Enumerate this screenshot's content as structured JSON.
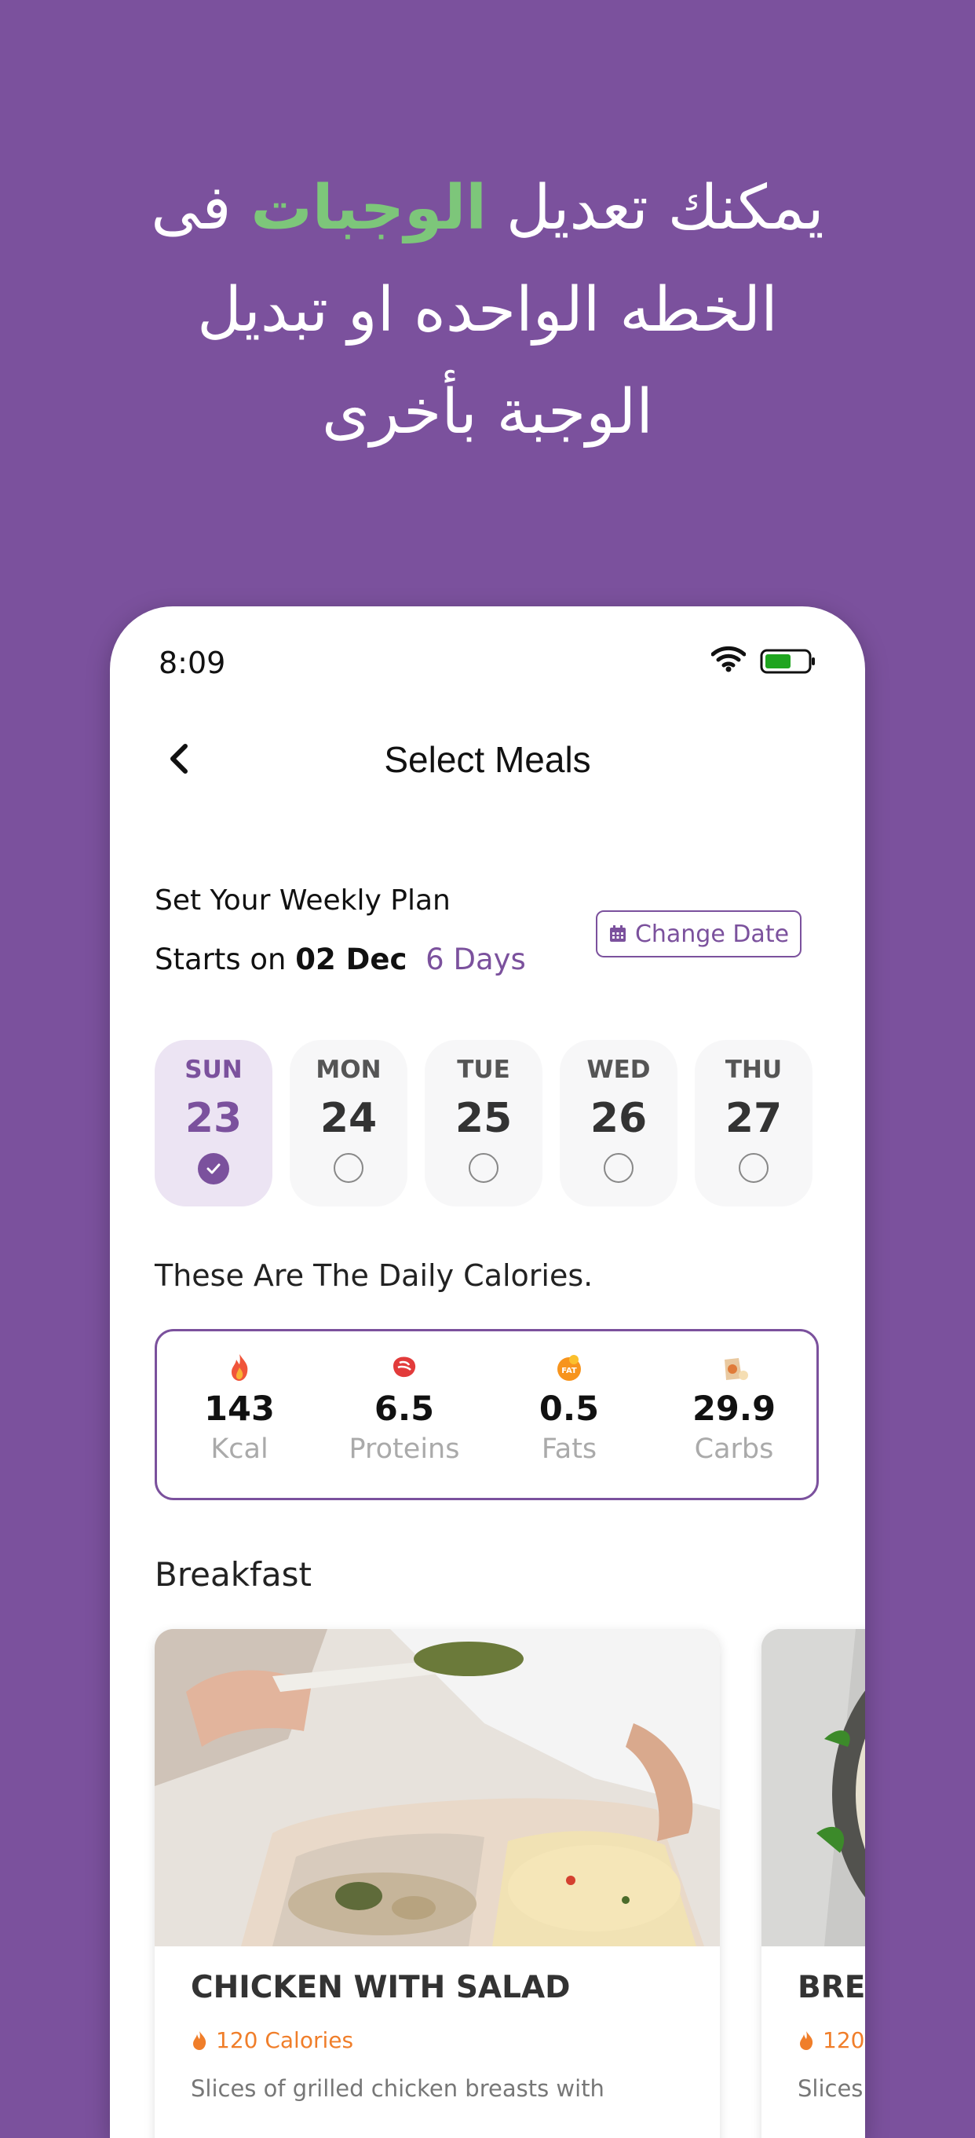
{
  "headline": {
    "part1": "يمكنك تعديل ",
    "highlight": "الوجبات",
    "part2": " فى",
    "line2": "الخطه الواحده او تبديل",
    "line3": "الوجبة بأخرى"
  },
  "status_bar": {
    "time": "8:09"
  },
  "nav": {
    "title": "Select Meals"
  },
  "plan": {
    "title": "Set Your Weekly Plan",
    "starts_prefix": "Starts on",
    "start_date": "02 Dec",
    "duration": "6 Days",
    "change_date_label": "Change Date"
  },
  "days": [
    {
      "name": "SUN",
      "num": "23",
      "selected": true
    },
    {
      "name": "MON",
      "num": "24",
      "selected": false
    },
    {
      "name": "TUE",
      "num": "25",
      "selected": false
    },
    {
      "name": "WED",
      "num": "26",
      "selected": false
    },
    {
      "name": "THU",
      "num": "27",
      "selected": false
    }
  ],
  "calories": {
    "title": "These Are The Daily Calories.",
    "macros": [
      {
        "value": "143",
        "label": "Kcal",
        "icon": "flame-icon"
      },
      {
        "value": "6.5",
        "label": "Proteins",
        "icon": "meat-icon"
      },
      {
        "value": "0.5",
        "label": "Fats",
        "icon": "fat-icon"
      },
      {
        "value": "29.9",
        "label": "Carbs",
        "icon": "carbs-icon"
      }
    ]
  },
  "breakfast": {
    "title": "Breakfast",
    "meals": [
      {
        "name": "CHICKEN WITH SALAD",
        "calories": "120 Calories",
        "desc": "Slices of grilled chicken breasts with"
      },
      {
        "name": "BREA",
        "calories": "120",
        "desc": "Slices"
      }
    ]
  },
  "colors": {
    "brand": "#7b519d",
    "accent_green": "#7dc67a",
    "calorie_orange": "#f07e2a"
  }
}
